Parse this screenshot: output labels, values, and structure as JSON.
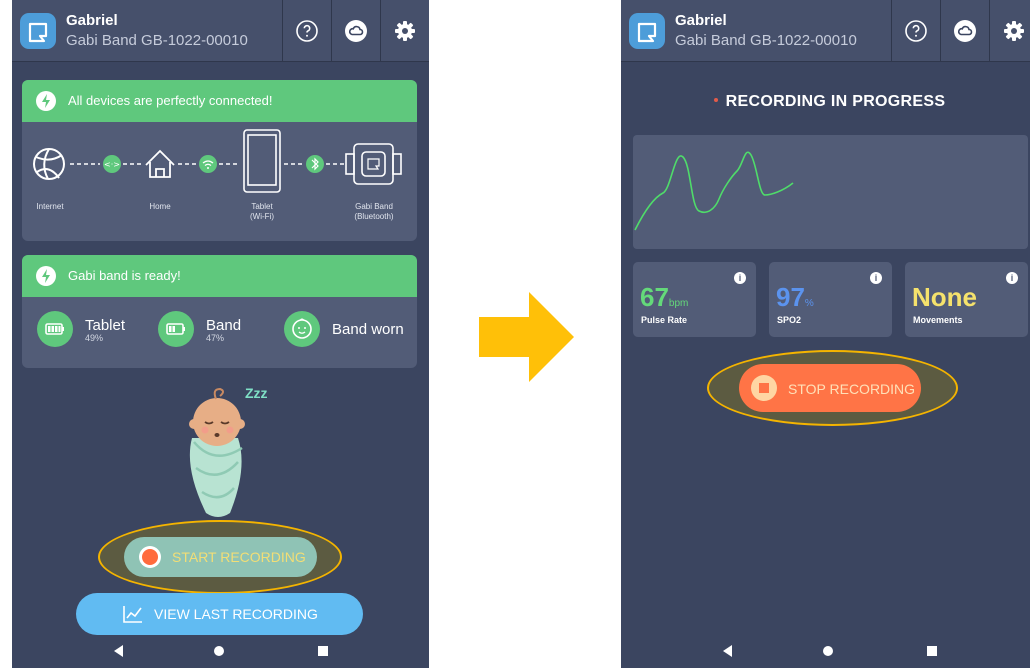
{
  "header": {
    "user_name": "Gabriel",
    "device_name": "Gabi Band GB-1022-00010",
    "help_icon": "help-circle-icon",
    "cloud_icon": "cloud-sync-icon",
    "settings_icon": "gear-icon"
  },
  "setup_screen": {
    "connection_card": {
      "banner": "All devices are perfectly connected!",
      "devices": [
        {
          "label": "Internet",
          "icon": "globe-icon"
        },
        {
          "label": "Home",
          "icon": "house-icon"
        },
        {
          "label": "Tablet\n(Wi-Fi)",
          "icon": "tablet-icon"
        },
        {
          "label": "Gabi Band\n(Bluetooth)",
          "icon": "band-icon"
        }
      ],
      "links": [
        "web-link-icon",
        "wifi-icon",
        "bluetooth-icon"
      ]
    },
    "ready_card": {
      "banner": "Gabi band is ready!",
      "items": [
        {
          "name": "Tablet",
          "sub": "49%",
          "icon": "battery-icon"
        },
        {
          "name": "Band",
          "sub": "47%",
          "icon": "battery-low-icon"
        },
        {
          "name": "Band worn",
          "sub": "",
          "icon": "baby-face-icon"
        }
      ]
    },
    "sleep_text": "Zzz",
    "start_button": "START RECORDING",
    "view_button": "VIEW LAST RECORDING"
  },
  "recording_screen": {
    "title": "RECORDING IN PROGRESS",
    "metrics": [
      {
        "value": "67",
        "unit": "bpm",
        "label": "Pulse Rate",
        "color": "#64d97a"
      },
      {
        "value": "97",
        "unit": "%",
        "label": "SPO2",
        "color": "#5b93ee"
      },
      {
        "value": "None",
        "unit": "",
        "label": "Movements",
        "color": "#f5e26c"
      }
    ],
    "stop_button": "STOP RECORDING"
  },
  "colors": {
    "background": "#3b4560",
    "card": "#525c77",
    "green": "#5fc87d",
    "highlight": "#f4b400",
    "stop": "#ff7446",
    "view": "#61bbf2"
  }
}
